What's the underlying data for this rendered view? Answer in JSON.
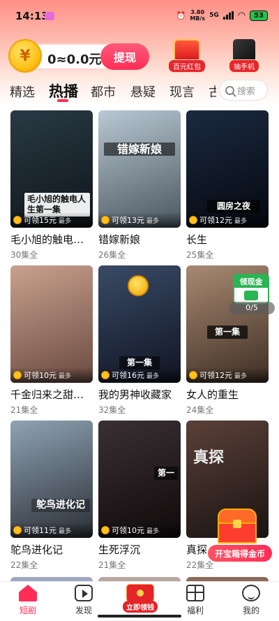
{
  "status_bar": {
    "time": "14:13",
    "net_speed_value": "3.80",
    "net_speed_unit": "MB/s",
    "network": "5G",
    "battery": "53"
  },
  "balance": {
    "coin_symbol": "¥",
    "amount": "0≈0.0元",
    "withdraw_label": "提现"
  },
  "promos": [
    {
      "label": "百元红包"
    },
    {
      "label": "抽手机"
    }
  ],
  "tabs": [
    {
      "label": "精选",
      "active": false
    },
    {
      "label": "热播",
      "active": true
    },
    {
      "label": "都市",
      "active": false
    },
    {
      "label": "悬疑",
      "active": false
    },
    {
      "label": "现言",
      "active": false
    },
    {
      "label": "古",
      "active": false
    }
  ],
  "search": {
    "placeholder": "搜索"
  },
  "dramas": [
    {
      "title": "毛小旭的触电…",
      "episodes": "30集全",
      "reward": "可领15元",
      "reward_suffix": "最多",
      "caption": "毛小旭的触电人生第一集",
      "colors": [
        "#2a3a44",
        "#0d141a"
      ]
    },
    {
      "title": "错嫁新娘",
      "episodes": "26集全",
      "reward": "可领13元",
      "reward_suffix": "最多",
      "caption": "错嫁新娘",
      "colors": [
        "#b9c8d2",
        "#4a5660"
      ]
    },
    {
      "title": "长生",
      "episodes": "25集全",
      "reward": "可领12元",
      "reward_suffix": "最多",
      "caption": "圆房之夜",
      "colors": [
        "#1b2a40",
        "#05080f"
      ]
    },
    {
      "title": "千金归来之甜…",
      "episodes": "21集全",
      "reward": "可领10元",
      "reward_suffix": "最多",
      "caption": "",
      "colors": [
        "#c9a08e",
        "#6a4a40"
      ]
    },
    {
      "title": "我的男神收藏家",
      "episodes": "32集全",
      "reward": "可领16元",
      "reward_suffix": "最多",
      "caption": "第一集",
      "colors": [
        "#3a4a66",
        "#0f1422"
      ]
    },
    {
      "title": "女人的重生",
      "episodes": "24集全",
      "reward": "可领12元",
      "reward_suffix": "最多",
      "caption": "第一集",
      "colors": [
        "#a88a72",
        "#3e2e24"
      ]
    },
    {
      "title": "鸵鸟进化记",
      "episodes": "22集全",
      "reward": "可领11元",
      "reward_suffix": "最多",
      "caption": "鸵鸟进化记",
      "colors": [
        "#8fa3b4",
        "#2b2f36"
      ]
    },
    {
      "title": "生死浮沉",
      "episodes": "21集全",
      "reward": "可领10元",
      "reward_suffix": "最多",
      "caption": "第一",
      "colors": [
        "#3a3033",
        "#0f0a0b"
      ]
    },
    {
      "title": "真探",
      "episodes": "22集全",
      "reward": "",
      "reward_suffix": "",
      "caption": "真探",
      "colors": [
        "#5a4038",
        "#1a1412"
      ]
    }
  ],
  "cash_widget": {
    "label": "领现金",
    "progress": "0/5"
  },
  "treasure": {
    "label": "开宝箱得金币"
  },
  "bottom_nav": [
    {
      "label": "短剧",
      "active": true
    },
    {
      "label": "发现",
      "active": false
    },
    {
      "label": "立即领钱",
      "active": false
    },
    {
      "label": "福利",
      "active": false
    },
    {
      "label": "我的",
      "active": false
    }
  ]
}
